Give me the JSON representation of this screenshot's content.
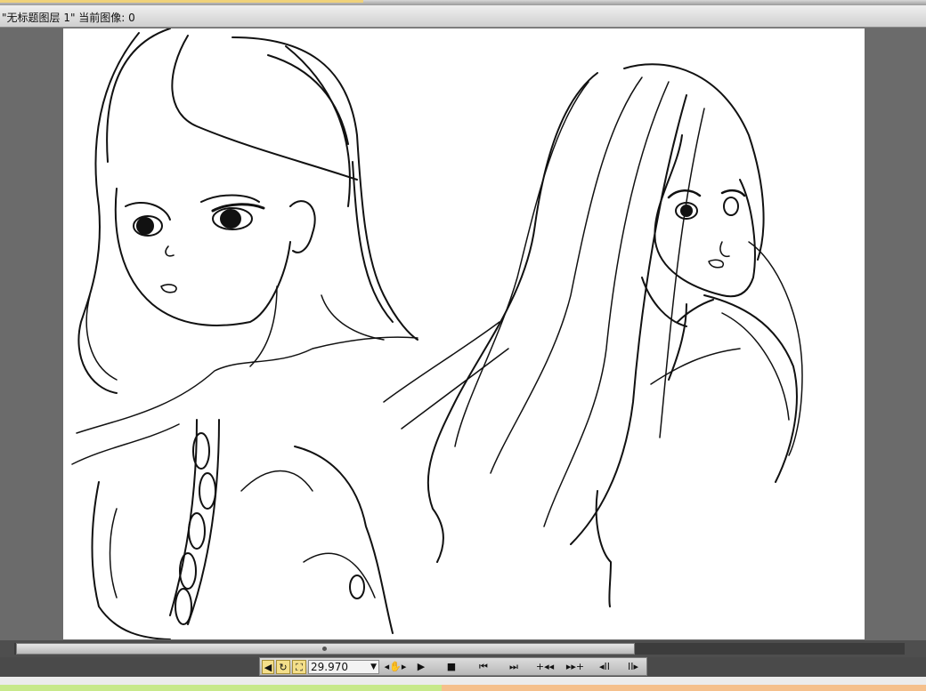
{
  "window": {
    "title": "\"无标题图层 1\"  当前图像: 0"
  },
  "transport": {
    "sound_icon": "speaker-icon",
    "loop_icon": "loop-icon",
    "fit_icon": "fit-frame-icon",
    "fps_value": "29.970",
    "buttons": [
      {
        "name": "hand-tool-button",
        "glyph": "◂✋▸"
      },
      {
        "name": "play-button",
        "glyph": "▶"
      },
      {
        "name": "stop-button",
        "glyph": "■"
      },
      {
        "name": "first-frame-button",
        "glyph": "⏮"
      },
      {
        "name": "last-frame-button",
        "glyph": "⏭"
      },
      {
        "name": "add-prev-frame-button",
        "glyph": "+◂◂"
      },
      {
        "name": "add-next-frame-button",
        "glyph": "▸▸+"
      },
      {
        "name": "prev-frame-button",
        "glyph": "◂II"
      },
      {
        "name": "next-frame-button",
        "glyph": "II▸"
      }
    ]
  },
  "colors": {
    "workspace": "#6b6b6b",
    "canvas": "#ffffff",
    "ink": "#111111",
    "highlight": "#f4df8a"
  }
}
